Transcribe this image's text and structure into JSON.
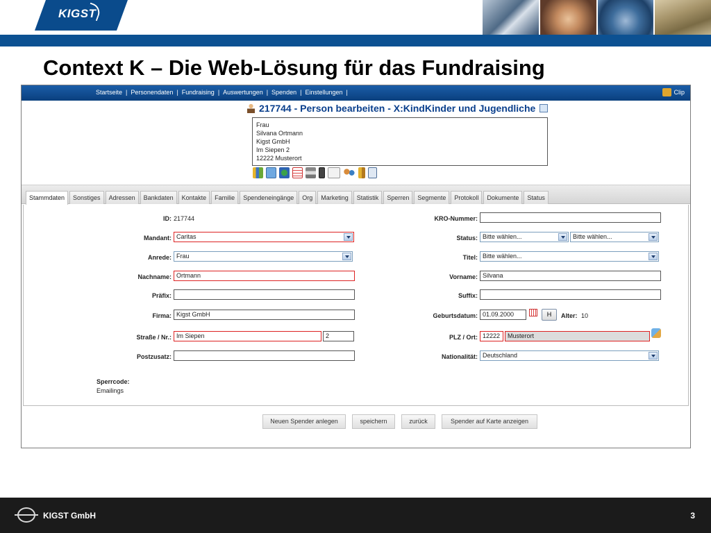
{
  "header": {
    "logo_text": "KIGST",
    "slide_title": "Context K – Die Web-Lösung für das Fundraising"
  },
  "app": {
    "nav_items": [
      "Startseite",
      "Personendaten",
      "Fundraising",
      "Auswertungen",
      "Spenden",
      "Einstellungen"
    ],
    "clip_label": "Clip",
    "person_title": "217744 - Person bearbeiten - X:KindKinder und Jugendliche",
    "address_lines": [
      "Frau",
      "Silvana Ortmann",
      "Kigst GmbH",
      "Im Siepen 2",
      "12222 Musterort"
    ],
    "tabs": [
      "Stammdaten",
      "Sonstiges",
      "Adressen",
      "Bankdaten",
      "Kontakte",
      "Familie",
      "Spendeneingänge",
      "Org",
      "Marketing",
      "Statistik",
      "Sperren",
      "Segmente",
      "Protokoll",
      "Dokumente",
      "Status"
    ],
    "active_tab": "Stammdaten",
    "form": {
      "id_label": "ID:",
      "id_value": "217744",
      "mandant_label": "Mandant:",
      "mandant_value": "Caritas",
      "anrede_label": "Anrede:",
      "anrede_value": "Frau",
      "nachname_label": "Nachname:",
      "nachname_value": "Ortmann",
      "praefix_label": "Präfix:",
      "praefix_value": "",
      "firma_label": "Firma:",
      "firma_value": "Kigst GmbH",
      "strasse_label": "Straße / Nr.:",
      "strasse_value": "Im Siepen",
      "nr_value": "2",
      "postzusatz_label": "Postzusatz:",
      "postzusatz_value": "",
      "kro_label": "KRO-Nummer:",
      "kro_value": "",
      "status_label": "Status:",
      "status_value_1": "Bitte wählen...",
      "status_value_2": "Bitte wählen...",
      "titel_label": "Titel:",
      "titel_value": "Bitte wählen...",
      "vorname_label": "Vorname:",
      "vorname_value": "Silvana",
      "suffix_label": "Suffix:",
      "suffix_value": "",
      "geburtsdatum_label": "Geburtsdatum:",
      "geburtsdatum_value": "01.09.2000",
      "h_button": "H",
      "alter_label": "Alter:",
      "alter_value": "10",
      "plz_label": "PLZ / Ort:",
      "plz_value": "12222",
      "ort_value": "Musterort",
      "nationalitaet_label": "Nationalität:",
      "nationalitaet_value": "Deutschland",
      "sperrcode_label": "Sperrcode:",
      "sperrcode_value": "Emailings"
    },
    "buttons": {
      "new_donor": "Neuen Spender anlegen",
      "save": "speichern",
      "back": "zurück",
      "map": "Spender auf Karte anzeigen"
    }
  },
  "footer": {
    "company": "KIGST GmbH",
    "page_number": "3"
  },
  "colors": {
    "brand_blue": "#0c5192",
    "title_blue": "#0a3f8c",
    "required_red": "#dd2222",
    "footer_bg": "#1b1b1b"
  }
}
